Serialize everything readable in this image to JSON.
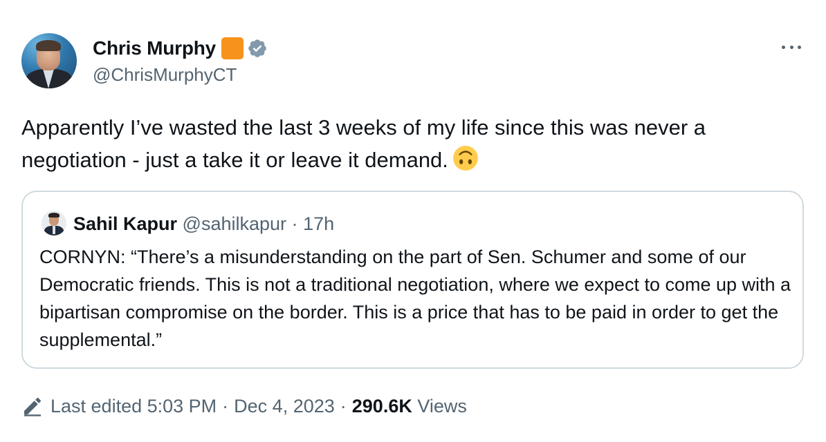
{
  "author": {
    "display_name": "Chris Murphy",
    "handle": "@ChrisMurphyCT",
    "badges": [
      "orange-square-icon",
      "verified-badge-icon"
    ]
  },
  "tweet": {
    "text": "Apparently I’ve wasted the last 3 weeks of my life since this was never a negotiation - just a take it or leave it demand.",
    "emoji": "upside-down-face-emoji"
  },
  "quoted": {
    "display_name": "Sahil Kapur",
    "handle": "@sahilkapur",
    "separator": "·",
    "time": "17h",
    "text": "CORNYN: “There’s a misunderstanding on the part of Sen. Schumer and some of our Democratic friends. This is not a traditional negotiation, where we expect to come up with a bipartisan compromise on the border. This is a price that has to be paid in order to get the supplemental.”"
  },
  "footer": {
    "edited_label": "Last edited 5:03 PM",
    "separator1": "·",
    "date": "Dec 4, 2023",
    "separator2": "·",
    "views_count": "290.6K",
    "views_label": "Views"
  },
  "colors": {
    "text": "#0f1419",
    "secondary": "#536471",
    "border": "#cfd9de",
    "verified": "#829aab",
    "affiliate": "#f7931a"
  }
}
